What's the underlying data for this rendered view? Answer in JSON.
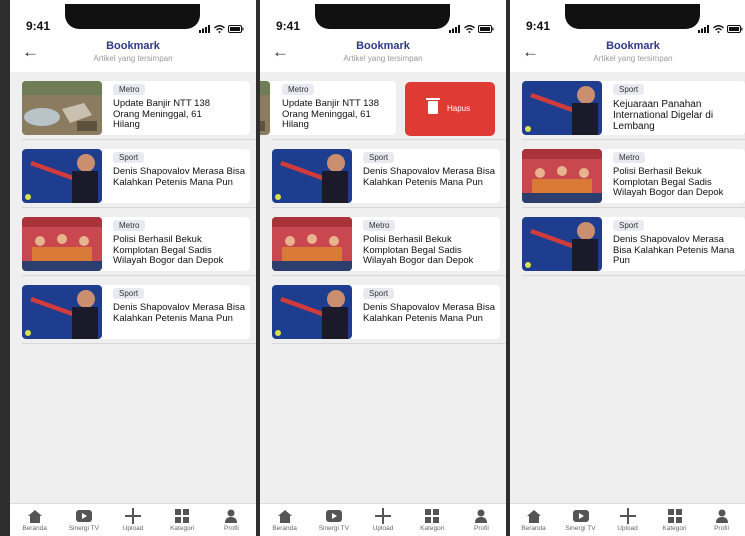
{
  "status": {
    "time": "9:41"
  },
  "header": {
    "title": "Bookmark",
    "subtitle": "Artikel yang tersimpan"
  },
  "articles": {
    "banjir": {
      "category": "Metro",
      "title": "Update Banjir NTT 138 Orang Meninggal, 61 Hilang"
    },
    "denis": {
      "category": "Sport",
      "title": "Denis Shapovalov Merasa Bisa Kalahkan Petenis Mana Pun"
    },
    "polisi": {
      "category": "Metro",
      "title": "Polisi Berhasil Bekuk Komplotan Begal Sadis Wilayah Bogor dan Depok"
    },
    "panahan": {
      "category": "Sport",
      "title": "Kejuaraan Panahan International Digelar di Lembang"
    }
  },
  "delete_label": "Hapus",
  "nav": {
    "beranda": "Beranda",
    "sinergi": "Sinergi TV",
    "upload": "Upload",
    "kategori": "Kategori",
    "profil": "Profil"
  }
}
